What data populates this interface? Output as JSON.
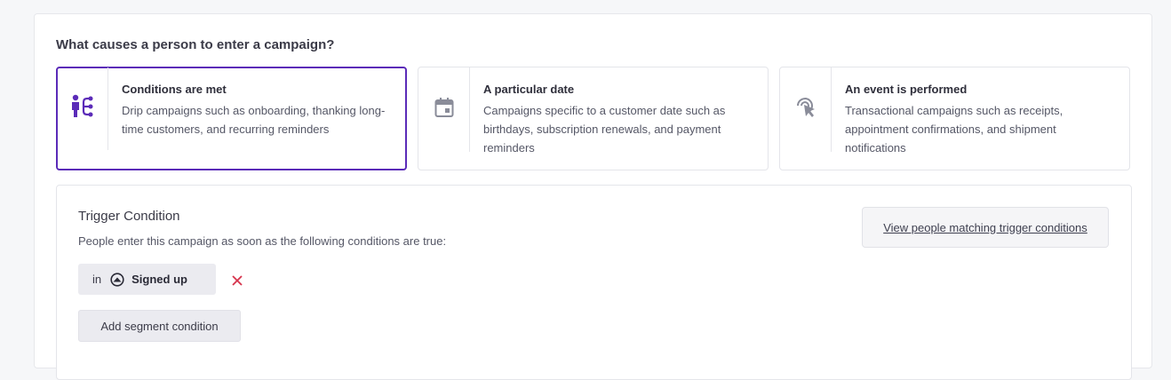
{
  "question": "What causes a person to enter a campaign?",
  "cards": [
    {
      "title": "Conditions are met",
      "desc": "Drip campaigns such as onboarding, thanking long-time customers, and recurring reminders",
      "icon": "person-branch-icon",
      "selected": true
    },
    {
      "title": "A particular date",
      "desc": "Campaigns specific to a customer date such as birthdays, subscription renewals, and payment reminders",
      "icon": "calendar-icon",
      "selected": false
    },
    {
      "title": "An event is performed",
      "desc": "Transactional campaigns such as receipts, appointment confirmations, and shipment notifications",
      "icon": "cursor-click-icon",
      "selected": false
    }
  ],
  "trigger": {
    "title": "Trigger Condition",
    "subtitle": "People enter this campaign as soon as the following conditions are true:",
    "view_button": "View people matching trigger conditions",
    "condition": {
      "prefix": "in",
      "segment": "Signed up",
      "icon": "segment-icon"
    },
    "add_button": "Add segment condition"
  },
  "colors": {
    "accent": "#5b2bb8",
    "remove": "#d6334c",
    "icon_muted": "#8a8c99"
  }
}
